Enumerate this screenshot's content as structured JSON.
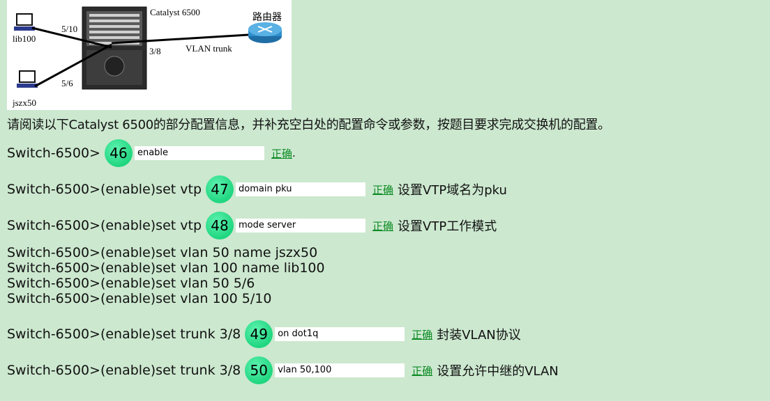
{
  "diagram": {
    "switch_label": "Catalyst 6500",
    "router_label": "路由器",
    "pc1_label": "lib100",
    "pc2_label": "jszx50",
    "port1": "5/10",
    "port2": "5/6",
    "port3": "3/8",
    "trunk_label": "VLAN trunk"
  },
  "instruction": "请阅读以下Catalyst 6500的部分配置信息，并补充空白处的配置命令或参数，按题目要求完成交换机的配置。",
  "correct_label": "正确",
  "questions": [
    {
      "prefix": "Switch-6500>",
      "number": "46",
      "answer": "enable",
      "note": "."
    },
    {
      "prefix": "Switch-6500>(enable)set vtp",
      "number": "47",
      "answer": "domain pku",
      "note": "设置VTP域名为pku"
    },
    {
      "prefix": "Switch-6500>(enable)set vtp",
      "number": "48",
      "answer": "mode server",
      "note": "设置VTP工作模式"
    },
    {
      "prefix": "Switch-6500>(enable)set trunk 3/8",
      "number": "49",
      "answer": "on dot1q",
      "note": "封装VLAN协议"
    },
    {
      "prefix": "Switch-6500>(enable)set trunk 3/8",
      "number": "50",
      "answer": "vlan 50,100",
      "note": "设置允许中继的VLAN"
    }
  ],
  "static_lines": [
    "Switch-6500>(enable)set vlan 50 name jszx50",
    "Switch-6500>(enable)set vlan 100 name lib100",
    "Switch-6500>(enable)set vlan 50 5/6",
    "Switch-6500>(enable)set vlan 100 5/10"
  ],
  "colors": {
    "background": "#cce8cf",
    "badge": "#1fd67f",
    "correct_link": "#0a8a22"
  }
}
